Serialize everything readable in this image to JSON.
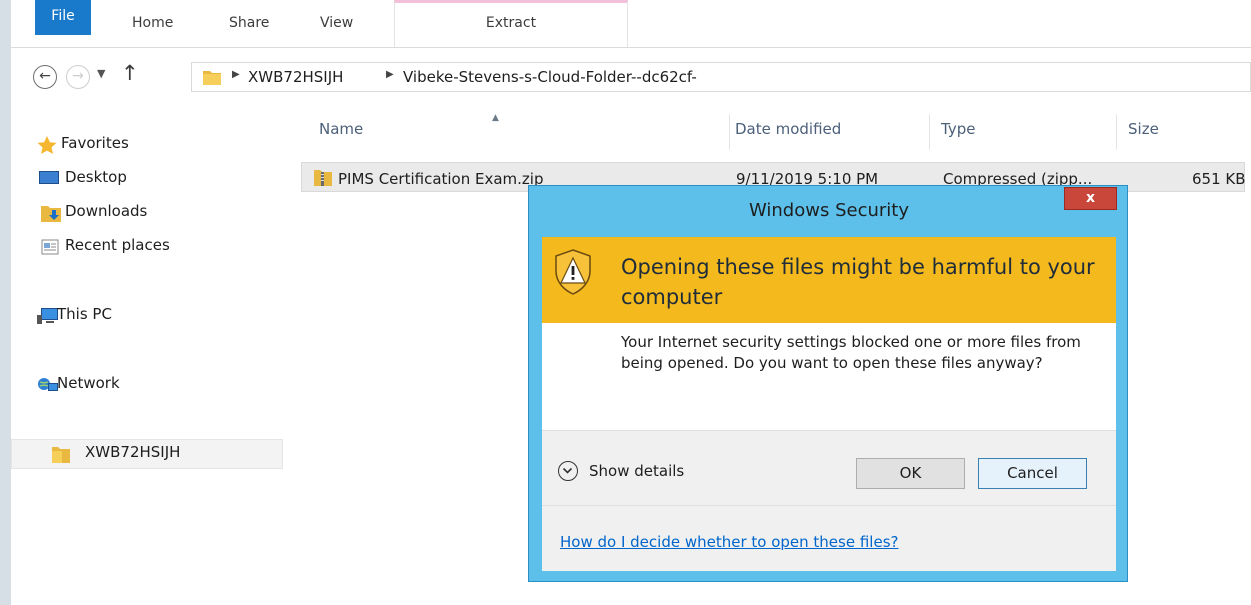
{
  "ribbon": {
    "tabs": [
      "File",
      "Home",
      "Share",
      "View",
      "Extract"
    ]
  },
  "address": {
    "crumbs": [
      "XWB72HSIJH",
      "Vibeke-Stevens-s-Cloud-Folder--dc62cf-"
    ]
  },
  "nav": {
    "favorites": "Favorites",
    "desktop": "Desktop",
    "downloads": "Downloads",
    "recent": "Recent places",
    "thispc": "This PC",
    "network": "Network",
    "folder": "XWB72HSIJH"
  },
  "list": {
    "columns": [
      "Name",
      "Date modified",
      "Type",
      "Size"
    ],
    "rows": [
      {
        "name": "PIMS Certification Exam.zip",
        "date": "9/11/2019 5:10 PM",
        "type": "Compressed (zipp...",
        "size": "651 KB"
      }
    ]
  },
  "dialog": {
    "title": "Windows Security",
    "close": "x",
    "heading": "Opening these files might be harmful to your computer",
    "message": "Your Internet security settings blocked one or more files from being opened. Do you want to open these files anyway?",
    "show_details": "Show details",
    "ok": "OK",
    "cancel": "Cancel",
    "link": "How do I decide whether to open these files?"
  },
  "colors": {
    "file_tab": "#1979ca",
    "banner": "#f4b91c",
    "dialog_frame": "#5cc0ea",
    "close_button": "#c8463a",
    "link": "#0066cc"
  },
  "icons": [
    "back-icon",
    "forward-icon",
    "chevron-down-icon",
    "up-arrow-icon",
    "folder-icon",
    "star-icon",
    "desktop-icon",
    "downloads-icon",
    "recent-places-icon",
    "computer-icon",
    "network-icon",
    "zip-folder-icon",
    "shield-warning-icon",
    "chevron-circle-icon"
  ]
}
